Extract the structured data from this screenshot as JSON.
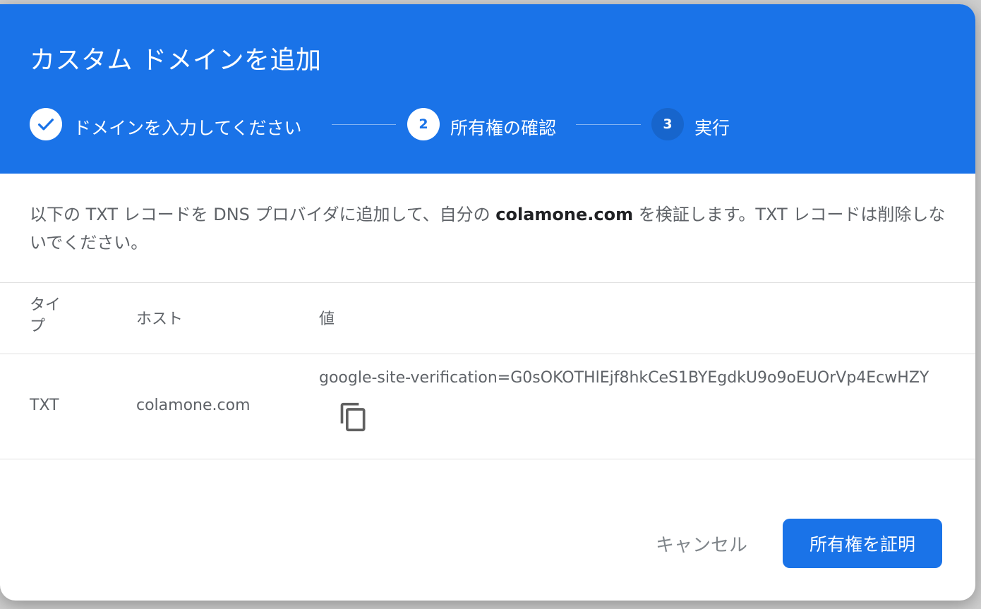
{
  "dialog": {
    "title": "カスタム ドメインを追加"
  },
  "stepper": {
    "steps": [
      {
        "number": "",
        "label": "ドメインを入力してください",
        "state": "completed",
        "icon": "check-icon"
      },
      {
        "number": "2",
        "label": "所有権の確認",
        "state": "active"
      },
      {
        "number": "3",
        "label": "実行",
        "state": "pending"
      }
    ]
  },
  "description": {
    "before": "以下の TXT レコードを DNS プロバイダに追加して、自分の ",
    "domain": "colamone.com",
    "after": " を検証します。TXT レコードは削除しないでください。"
  },
  "table": {
    "headers": {
      "type": "タイプ",
      "host": "ホスト",
      "value": "値"
    },
    "rows": [
      {
        "type": "TXT",
        "host": "colamone.com",
        "value": "google-site-verification=G0sOKOTHlEjf8hkCeS1BYEgdkU9o9oEUOrVp4EcwHZY",
        "copy_icon": "copy-icon"
      }
    ]
  },
  "actions": {
    "cancel_label": "キャンセル",
    "confirm_label": "所有権を証明"
  },
  "colors": {
    "header": "#1a73e8",
    "primary_button": "#1a73e8",
    "pending_step": "#1765cc",
    "text_secondary": "#5f6368"
  }
}
